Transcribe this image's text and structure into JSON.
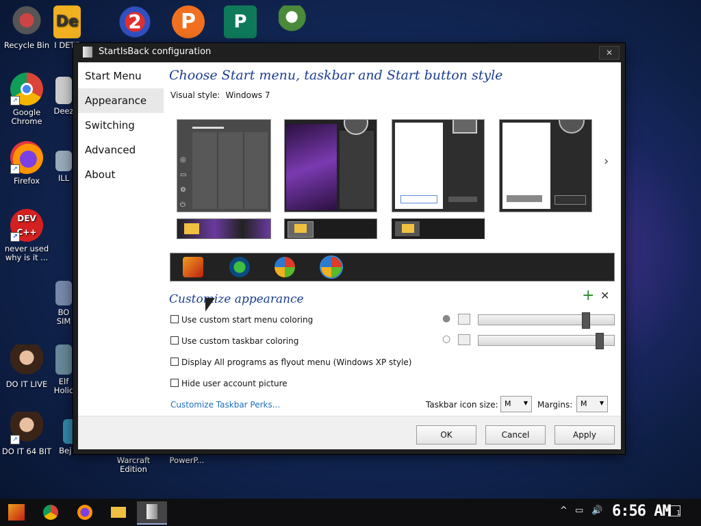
{
  "desktop": {
    "icons": [
      {
        "label": "Recycle Bin"
      },
      {
        "label": "I DETE"
      },
      {
        "label": "Google Chrome"
      },
      {
        "label": "Deez"
      },
      {
        "label": "Firefox"
      },
      {
        "label": "ILL"
      },
      {
        "label": "never used why is it ..."
      },
      {
        "label": "BO SIM"
      },
      {
        "label": "DO IT LIVE"
      },
      {
        "label": "Elf Holic"
      },
      {
        "label": "DO IT 64 BIT"
      },
      {
        "label": "Bej Deluxe"
      },
      {
        "label": "Warcraft Edition"
      },
      {
        "label": "PowerP..."
      }
    ]
  },
  "dialog": {
    "title": "StartIsBack configuration",
    "close_glyph": "✕",
    "nav": [
      "Start Menu",
      "Appearance",
      "Switching",
      "Advanced",
      "About"
    ],
    "active_nav": "Appearance",
    "heading": "Choose Start menu, taskbar and Start button style",
    "visual_style_label": "Visual style:",
    "visual_style_value": "Windows 7",
    "next_glyph": "›",
    "customize_heading": "Customize appearance",
    "options": [
      "Use custom start menu coloring",
      "Use custom taskbar coloring",
      "Display All programs as flyout menu (Windows XP style)",
      "Hide user account picture"
    ],
    "sliders": [
      {
        "level": 0.79
      },
      {
        "level": 0.89
      }
    ],
    "link": "Customize Taskbar Perks...",
    "taskbar_icon_size_label": "Taskbar icon size:",
    "taskbar_icon_size_value": "M",
    "margins_label": "Margins:",
    "margins_value": "M",
    "buttons": {
      "ok": "OK",
      "cancel": "Cancel",
      "apply": "Apply"
    }
  },
  "taskbar": {
    "clock": "6:56 AM",
    "tray_up": "^",
    "tray_volume": "🔊",
    "notif": "1"
  }
}
